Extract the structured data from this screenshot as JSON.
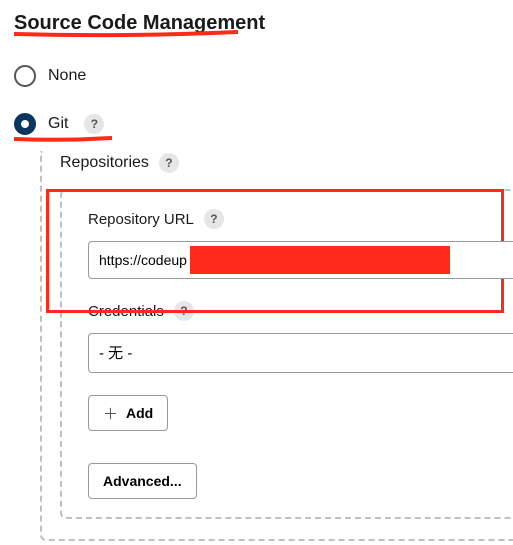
{
  "section": {
    "title": "Source Code Management"
  },
  "scm": {
    "options": {
      "none": {
        "label": "None",
        "selected": false
      },
      "git": {
        "label": "Git",
        "selected": true
      }
    }
  },
  "repositories": {
    "label": "Repositories",
    "url": {
      "label": "Repository URL",
      "value": "https://codeup                                                            git"
    },
    "credentials": {
      "label": "Credentials",
      "selected": "- 无 -",
      "add_label": "Add"
    },
    "advanced_label": "Advanced..."
  },
  "help_glyph": "?"
}
